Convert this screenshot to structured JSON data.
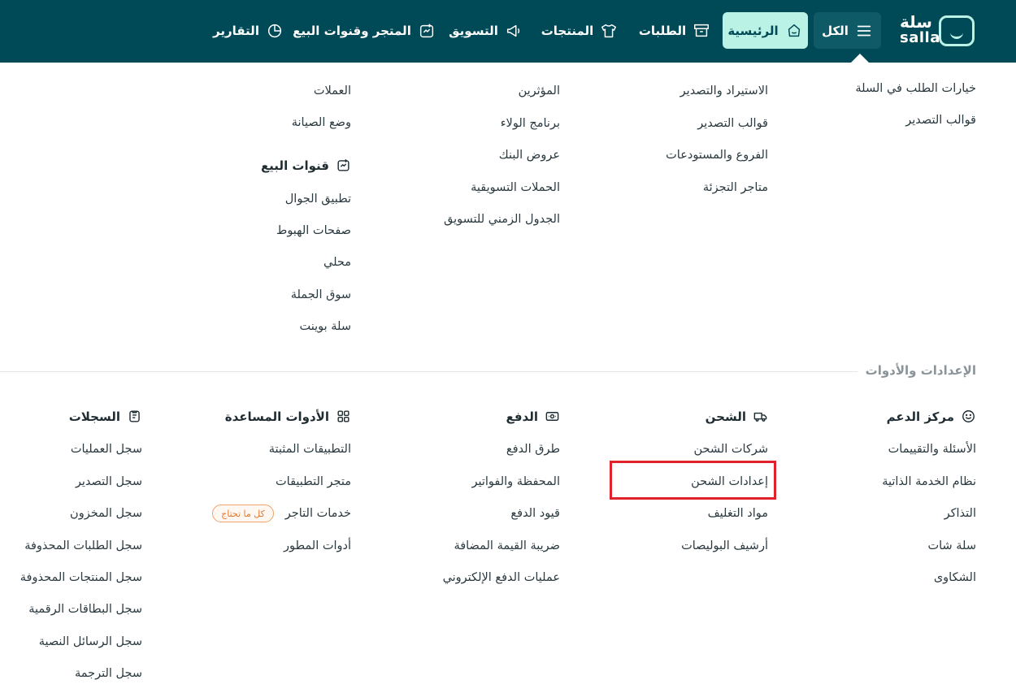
{
  "brand": {
    "name_ar": "سلة",
    "name_en": "salla"
  },
  "nav": {
    "all": "الكل",
    "home": "الرئيسية",
    "orders": "الطلبات",
    "products": "المنتجات",
    "marketing": "التسويق",
    "store": "المتجر وقنوات البيع",
    "reports": "التقارير"
  },
  "top": {
    "col_a": [
      "خيارات الطلب في السلة",
      "قوالب التصدير"
    ],
    "col_b": [
      "الاستيراد والتصدير",
      "قوالب التصدير",
      "الفروع والمستودعات",
      "متاجر التجزئة"
    ],
    "col_c": [
      "المؤثرين",
      "برنامج الولاء",
      "عروض البنك",
      "الحملات التسويقية",
      "الجدول الزمني للتسويق"
    ],
    "col_d": [
      "العملات",
      "وضع الصيانة"
    ],
    "sales_channels": {
      "title": "قنوات البيع",
      "items": [
        "تطبيق الجوال",
        "صفحات الهبوط",
        "محلي",
        "سوق الجملة",
        "سلة بوينت"
      ]
    }
  },
  "settings_section": {
    "title": "الإعدادات والأدوات",
    "support": {
      "title": "مركز الدعم",
      "items": [
        "الأسئلة والتقييمات",
        "نظام الخدمة الذاتية",
        "التذاكر",
        "سلة شات",
        "الشكاوى"
      ]
    },
    "shipping": {
      "title": "الشحن",
      "items": [
        "شركات الشحن",
        "إعدادات الشحن",
        "مواد التغليف",
        "أرشيف البوليصات"
      ]
    },
    "payment": {
      "title": "الدفع",
      "items": [
        "طرق الدفع",
        "المحفظة والفواتير",
        "قيود الدفع",
        "ضريبة القيمة المضافة",
        "عمليات الدفع الإلكتروني"
      ]
    },
    "tools": {
      "title": "الأدوات المساعدة",
      "items": [
        "التطبيقات المثبتة",
        "متجر التطبيقات",
        "خدمات التاجر",
        "أدوات المطور"
      ],
      "badge": "كل ما تحتاج"
    },
    "logs": {
      "title": "السجلات",
      "items": [
        "سجل العمليات",
        "سجل التصدير",
        "سجل المخزون",
        "سجل الطلبات المحذوفة",
        "سجل المنتجات المحذوفة",
        "سجل البطاقات الرقمية",
        "سجل الرسائل النصية",
        "سجل الترجمة"
      ]
    }
  },
  "colors": {
    "navbar": "#004956",
    "accent": "#baf3e6",
    "highlight": "#e1212c",
    "badge": "#e07b33"
  }
}
